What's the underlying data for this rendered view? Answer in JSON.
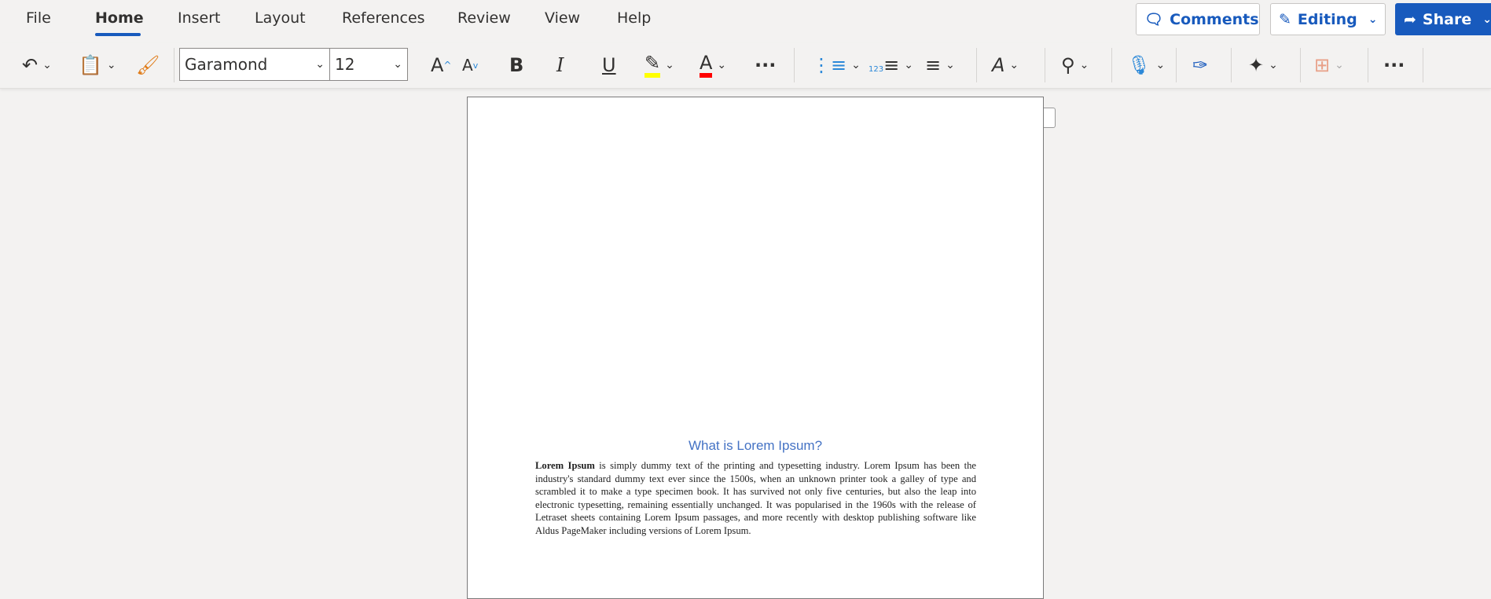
{
  "tabs": [
    {
      "label": "File"
    },
    {
      "label": "Home"
    },
    {
      "label": "Insert"
    },
    {
      "label": "Layout"
    },
    {
      "label": "References"
    },
    {
      "label": "Review"
    },
    {
      "label": "View"
    },
    {
      "label": "Help"
    }
  ],
  "actions": {
    "comments": "Comments",
    "editing": "Editing",
    "share": "Share"
  },
  "toolbar": {
    "font": "Garamond",
    "size": "12",
    "bold": "B",
    "italic": "I",
    "underline": "U",
    "grow": "A",
    "shrink": "A",
    "font_color": "A",
    "more": "···",
    "highlight_color": "#ffff00",
    "font_color_value": "#ff0000"
  },
  "document": {
    "heading": "What is Lorem Ipsum?",
    "bold_lead": "Lorem Ipsum",
    "body": " is simply dummy text of the printing and typesetting industry. Lorem Ipsum has been the industry's standard dummy text ever since the 1500s, when an unknown printer took a galley of type and scrambled it to make a type specimen book. It has survived not only five centuries, but also the leap into electronic typesetting, remaining essentially unchanged. It was popularised in the 1960s with the release of Letraset sheets containing Lorem Ipsum passages, and more recently with desktop publishing software like Aldus PageMaker including versions of Lorem Ipsum."
  }
}
